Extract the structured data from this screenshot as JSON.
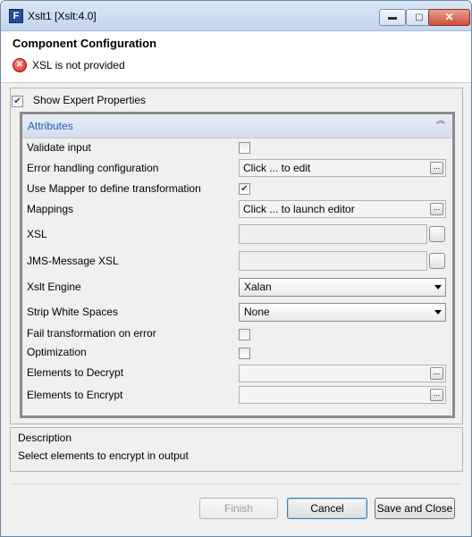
{
  "window": {
    "title": "Xslt1 [Xslt:4.0]",
    "app_icon_letter": "F",
    "minimize_glyph": "▬",
    "maximize_glyph": "▢",
    "close_glyph": "✕"
  },
  "header": {
    "title": "Component Configuration",
    "error_message": "XSL is not provided",
    "error_glyph": "✕"
  },
  "expert": {
    "label": "Show Expert Properties",
    "checked": true
  },
  "attributes": {
    "section_title": "Attributes",
    "collapse_glyph": "⌃⌃",
    "rows": [
      {
        "label": "Validate input",
        "type": "checkbox",
        "checked": false
      },
      {
        "label": "Error handling configuration",
        "type": "button-field",
        "value": "Click ... to edit"
      },
      {
        "label": "Use Mapper to define transformation",
        "type": "checkbox",
        "checked": true
      },
      {
        "label": "Mappings",
        "type": "button-field",
        "value": "Click ... to launch editor"
      },
      {
        "label": "XSL",
        "type": "text-area",
        "value": ""
      },
      {
        "label": "JMS-Message XSL",
        "type": "text-area",
        "value": ""
      },
      {
        "label": "Xslt Engine",
        "type": "select",
        "value": "Xalan"
      },
      {
        "label": "Strip White Spaces",
        "type": "select",
        "value": "None"
      },
      {
        "label": "Fail transformation on error",
        "type": "checkbox",
        "checked": false
      },
      {
        "label": "Optimization",
        "type": "checkbox",
        "checked": false
      },
      {
        "label": "Elements to Decrypt",
        "type": "button-field",
        "value": ""
      },
      {
        "label": "Elements to Encrypt",
        "type": "button-field",
        "value": ""
      }
    ],
    "dots_label": "..."
  },
  "description": {
    "title": "Description",
    "text": "Select elements to encrypt in output"
  },
  "buttons": {
    "finish": "Finish",
    "cancel": "Cancel",
    "save_close": "Save and Close"
  },
  "colors": {
    "attributes_title": "#2b5bb5",
    "error_icon": "#d42020"
  }
}
